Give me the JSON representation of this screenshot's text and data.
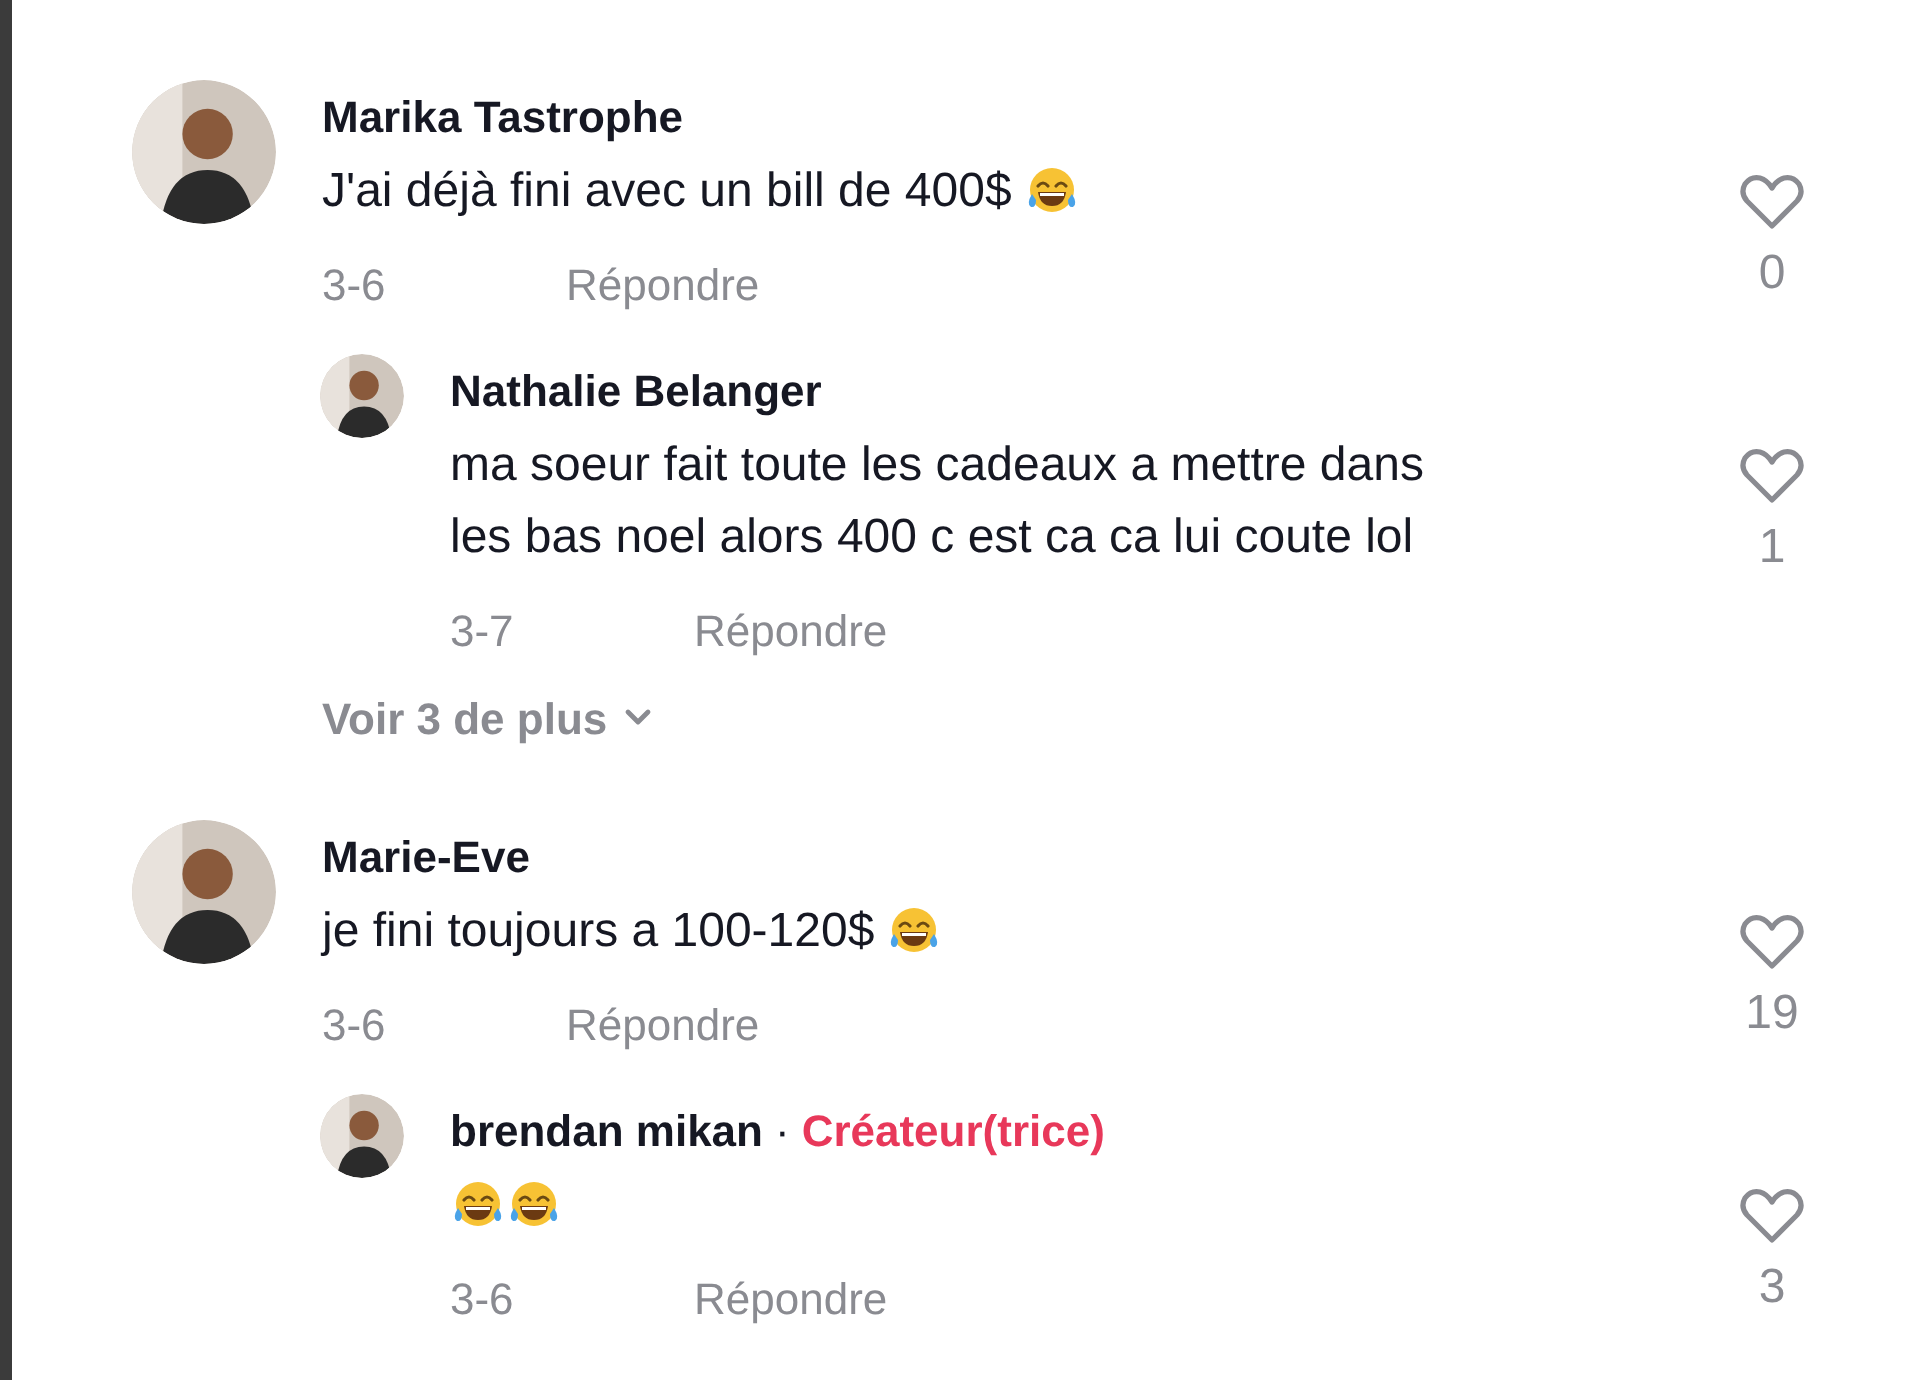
{
  "comments": [
    {
      "author": "Marika Tastrophe",
      "text": "J'ai déjà fini avec un bill de 400$",
      "emoji": [
        {
          "kind": "laughing"
        }
      ],
      "date": "3-6",
      "reply_label": "Répondre",
      "likes": "0",
      "avatar": {
        "kind": "picture"
      },
      "replies": [
        {
          "author": "Nathalie Belanger",
          "text": "ma soeur fait toute les cadeaux a mettre dans les bas noel alors 400 c est ca ca lui coute lol",
          "date": "3-7",
          "reply_label": "Répondre",
          "likes": "1",
          "avatar": {
            "kind": "picture"
          }
        }
      ],
      "more_replies": "Voir 3 de plus"
    },
    {
      "author": "Marie-Eve",
      "text": "je fini toujours a 100-120$",
      "emoji": [
        {
          "kind": "laughing"
        }
      ],
      "date": "3-6",
      "reply_label": "Répondre",
      "likes": "19",
      "avatar": {
        "kind": "picture"
      },
      "replies": [
        {
          "author": "brendan mikan",
          "separator": "·",
          "badge": "Créateur(trice)",
          "emoji": [
            {
              "kind": "laughing"
            },
            {
              "kind": "laughing"
            }
          ],
          "date": "3-6",
          "reply_label": "Répondre",
          "likes": "3",
          "avatar": {
            "kind": "picture"
          }
        }
      ]
    }
  ]
}
